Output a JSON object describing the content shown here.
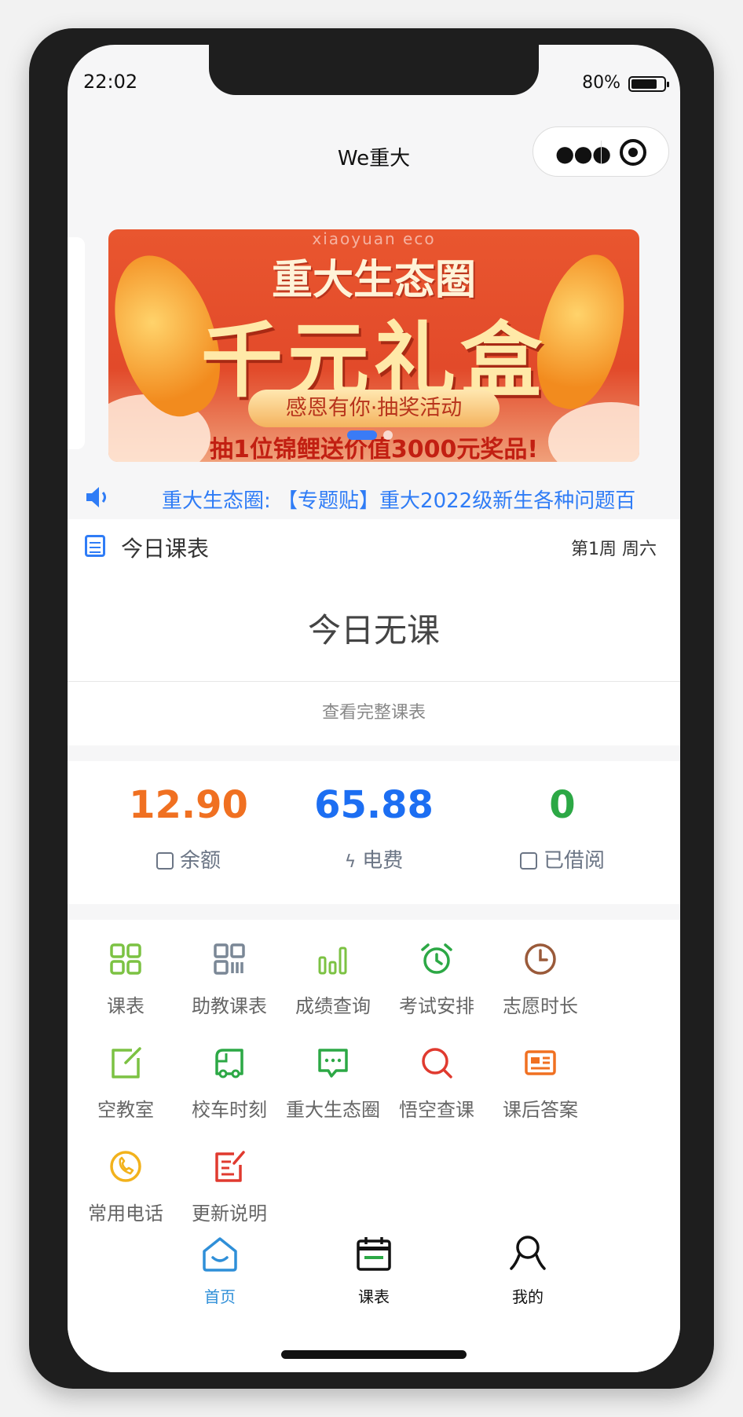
{
  "status_bar": {
    "time": "22:02",
    "battery": "80%",
    "battery_level": 0.8
  },
  "nav": {
    "title": "We重大"
  },
  "banner": {
    "eco": "xiaoyuan eco",
    "title": "重大生态圈",
    "big": "千元礼盒",
    "pill": "感恩有你·抽奖活动",
    "bottom": "抽1位锦鲤送价值3000元奖品!"
  },
  "notice": {
    "text": "重大生态圈: 【专题贴】重大2022级新生各种问题百"
  },
  "schedule": {
    "title": "今日课表",
    "week": "第1周 周六",
    "empty": "今日无课",
    "view_all": "查看完整课表"
  },
  "stats": [
    {
      "value": "12.90",
      "label": "余额",
      "color": "#f07021"
    },
    {
      "value": "65.88",
      "label": "电费",
      "color": "#1c6ef2"
    },
    {
      "value": "0",
      "label": "已借阅",
      "color": "#2ca845"
    }
  ],
  "grid": [
    {
      "label": "课表",
      "icon": "grid-icon",
      "color": "#7cc243"
    },
    {
      "label": "助教课表",
      "icon": "qr-grid-icon",
      "color": "#7a8796"
    },
    {
      "label": "成绩查询",
      "icon": "bar-chart-icon",
      "color": "#7cc243"
    },
    {
      "label": "考试安排",
      "icon": "alarm-clock-icon",
      "color": "#2ca845"
    },
    {
      "label": "志愿时长",
      "icon": "clock-icon",
      "color": "#9a5a3a"
    },
    {
      "label": "空教室",
      "icon": "edit-square-icon",
      "color": "#7cc243"
    },
    {
      "label": "校车时刻",
      "icon": "bus-icon",
      "color": "#2ca845"
    },
    {
      "label": "重大生态圈",
      "icon": "chat-bubble-icon",
      "color": "#2ca845"
    },
    {
      "label": "悟空查课",
      "icon": "search-icon",
      "color": "#e03a2f"
    },
    {
      "label": "课后答案",
      "icon": "card-icon",
      "color": "#f07021"
    },
    {
      "label": "常用电话",
      "icon": "phone-icon",
      "color": "#f2b21c"
    },
    {
      "label": "更新说明",
      "icon": "note-edit-icon",
      "color": "#e03a2f"
    }
  ],
  "tabs": [
    {
      "label": "首页",
      "icon": "home-icon",
      "active": true
    },
    {
      "label": "课表",
      "icon": "calendar-icon",
      "active": false
    },
    {
      "label": "我的",
      "icon": "user-icon",
      "active": false
    }
  ]
}
